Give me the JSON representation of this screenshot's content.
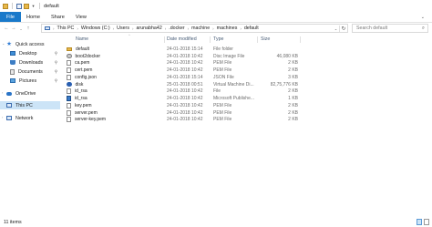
{
  "window": {
    "title": "default"
  },
  "ribbon": {
    "tabs": [
      "File",
      "Home",
      "Share",
      "View"
    ],
    "expand_icon": "chevron-down-icon"
  },
  "address": {
    "crumbs": [
      "This PC",
      "Windows (C:)",
      "Users",
      "arunabha42",
      ".docker",
      "machine",
      "machines",
      "default"
    ],
    "search_placeholder": "Search default"
  },
  "nav": {
    "quick_access": "Quick access",
    "items": [
      {
        "label": "Desktop",
        "pinned": true
      },
      {
        "label": "Downloads",
        "pinned": true
      },
      {
        "label": "Documents",
        "pinned": true
      },
      {
        "label": "Pictures",
        "pinned": true
      }
    ],
    "onedrive": "OneDrive",
    "this_pc": "This PC",
    "network": "Network"
  },
  "columns": {
    "name": "Name",
    "date": "Date modified",
    "type": "Type",
    "size": "Size"
  },
  "files": [
    {
      "icon": "folder-icon",
      "name": "default",
      "date": "24-01-2018 15:14",
      "type": "File folder",
      "size": ""
    },
    {
      "icon": "disc-image-icon",
      "name": "boot2docker",
      "date": "24-01-2018 10:42",
      "type": "Disc Image File",
      "size": "46,080 KB"
    },
    {
      "icon": "pem-file-icon",
      "name": "ca.pem",
      "date": "24-01-2018 10:42",
      "type": "PEM File",
      "size": "2 KB"
    },
    {
      "icon": "pem-file-icon",
      "name": "cert.pem",
      "date": "24-01-2018 10:42",
      "type": "PEM File",
      "size": "2 KB"
    },
    {
      "icon": "json-file-icon",
      "name": "config.json",
      "date": "24-01-2018 15:14",
      "type": "JSON File",
      "size": "3 KB"
    },
    {
      "icon": "virtual-disk-icon",
      "name": "disk",
      "date": "25-01-2018 00:51",
      "type": "Virtual Machine Di...",
      "size": "82,75,776 KB"
    },
    {
      "icon": "file-icon",
      "name": "id_rsa",
      "date": "24-01-2018 10:42",
      "type": "File",
      "size": "2 KB"
    },
    {
      "icon": "publisher-file-icon",
      "name": "id_rsa",
      "date": "24-01-2018 10:42",
      "type": "Microsoft Publishe...",
      "size": "1 KB"
    },
    {
      "icon": "pem-file-icon",
      "name": "key.pem",
      "date": "24-01-2018 10:42",
      "type": "PEM File",
      "size": "2 KB"
    },
    {
      "icon": "pem-file-icon",
      "name": "server.pem",
      "date": "24-01-2018 10:42",
      "type": "PEM File",
      "size": "2 KB"
    },
    {
      "icon": "pem-file-icon",
      "name": "server-key.pem",
      "date": "24-01-2018 10:42",
      "type": "PEM File",
      "size": "2 KB"
    }
  ],
  "status": {
    "items_count": "11 items"
  },
  "colors": {
    "file_tab": "#1979ca",
    "selected": "#cce4f7",
    "header_text": "#4c607a"
  }
}
